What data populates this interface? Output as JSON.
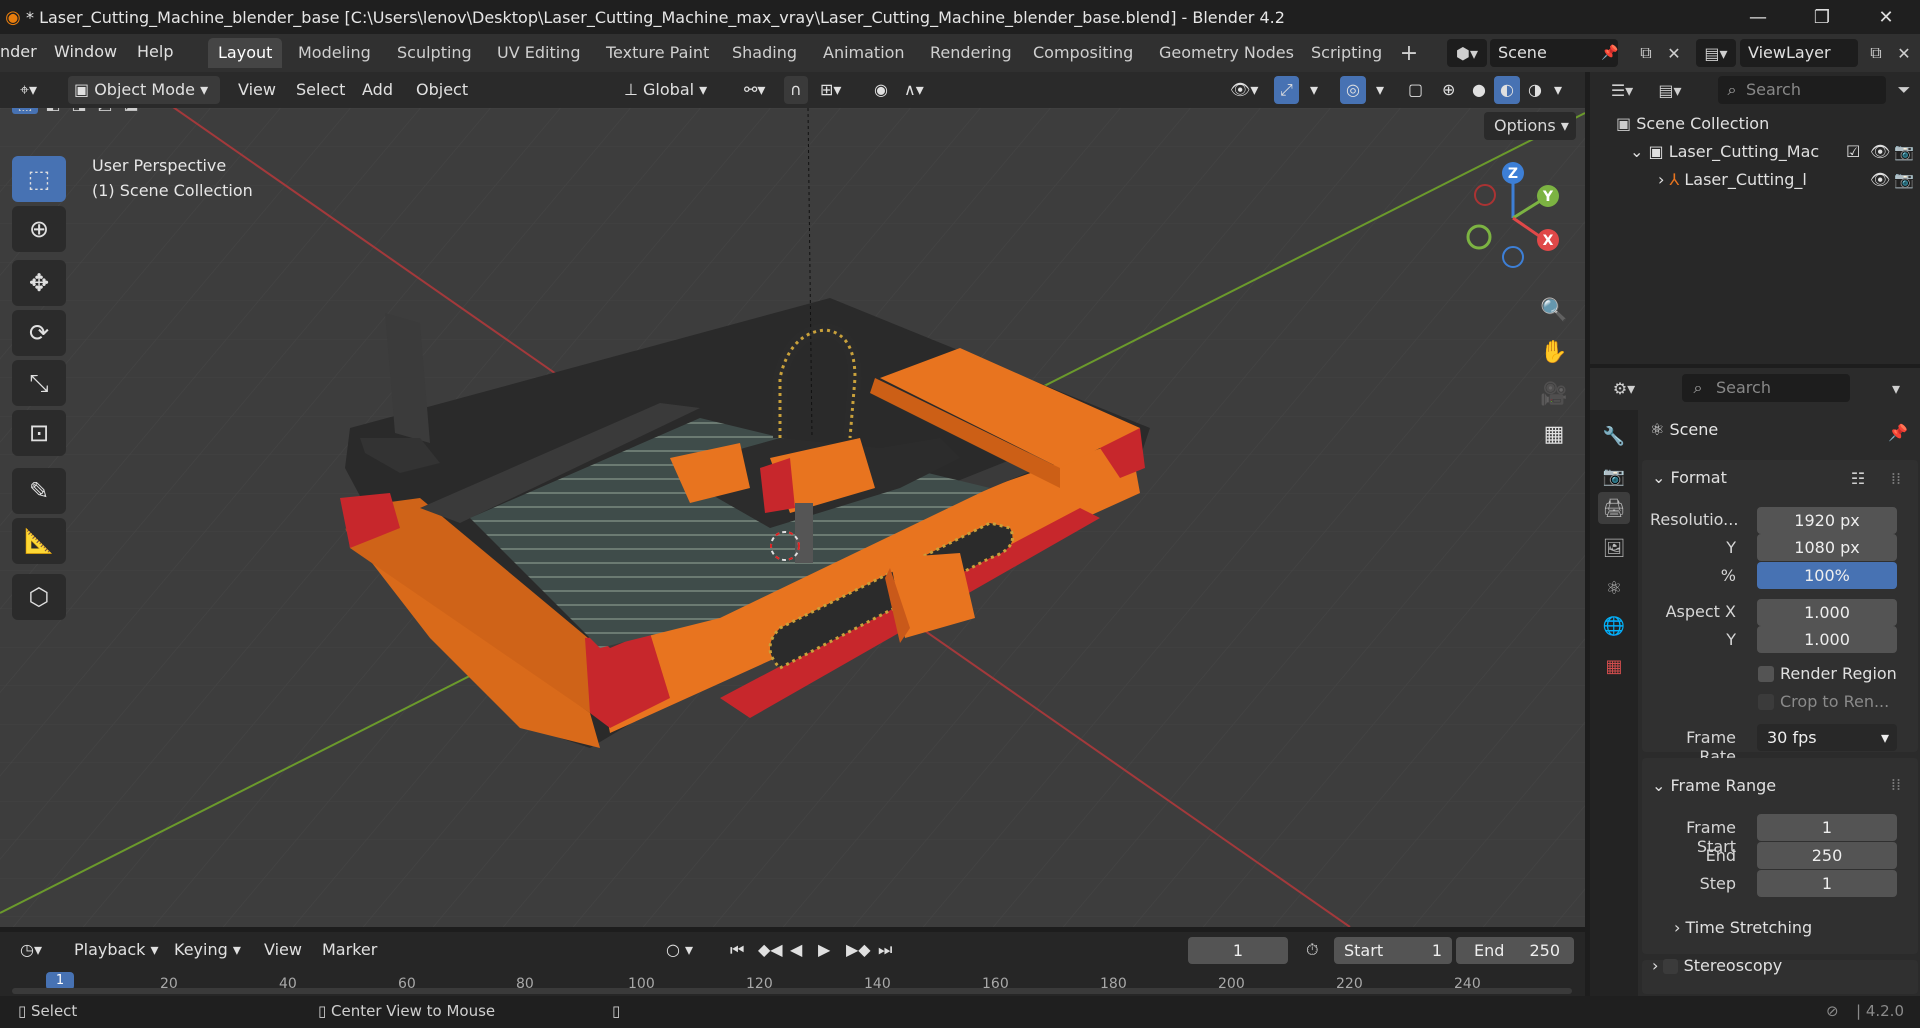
{
  "window": {
    "title": "* Laser_Cutting_Machine_blender_base [C:\\Users\\lenov\\Desktop\\Laser_Cutting_Machine_max_vray\\Laser_Cutting_Machine_blender_base.blend] - Blender 4.2"
  },
  "menus": [
    "nder",
    "Window",
    "Help"
  ],
  "workspaces": [
    "Layout",
    "Modeling",
    "Sculpting",
    "UV Editing",
    "Texture Paint",
    "Shading",
    "Animation",
    "Rendering",
    "Compositing",
    "Geometry Nodes",
    "Scripting"
  ],
  "scene_field": "Scene",
  "viewlayer_field": "ViewLayer",
  "viewport_header": {
    "mode": "Object Mode",
    "menus": [
      "View",
      "Select",
      "Add",
      "Object"
    ],
    "transform": "Global",
    "options": "Options"
  },
  "viewport": {
    "perspective": "User Perspective",
    "collection": "(1) Scene Collection",
    "gizmo": {
      "x": "X",
      "y": "Y",
      "z": "Z"
    }
  },
  "outliner": {
    "search_placeholder": "Search",
    "root": "Scene Collection",
    "items": [
      "Laser_Cutting_Mac",
      "Laser_Cutting_l"
    ]
  },
  "properties": {
    "search_placeholder": "Search",
    "context": "Scene",
    "format": {
      "header": "Format",
      "resolution_label": "Resolutio...",
      "res_x": "1920 px",
      "y_label": "Y",
      "res_y": "1080 px",
      "pct_label": "%",
      "pct": "100%",
      "aspect_label": "Aspect X",
      "aspect_x": "1.000",
      "aspect_y_label": "Y",
      "aspect_y": "1.000",
      "render_region": "Render Region",
      "crop": "Crop to Ren...",
      "frame_rate_label": "Frame Rate",
      "frame_rate": "30 fps"
    },
    "frame_range": {
      "header": "Frame Range",
      "start_label": "Frame Start",
      "start": "1",
      "end_label": "End",
      "end": "250",
      "step_label": "Step",
      "step": "1",
      "time_stretching": "Time Stretching",
      "stereoscopy": "Stereoscopy"
    }
  },
  "timeline": {
    "menus": [
      "Playback",
      "Keying",
      "View",
      "Marker"
    ],
    "current_frame": "1",
    "start_label": "Start",
    "start": "1",
    "end_label": "End",
    "end": "250",
    "ruler": [
      "1",
      "20",
      "40",
      "60",
      "80",
      "100",
      "120",
      "140",
      "160",
      "180",
      "200",
      "220",
      "240"
    ]
  },
  "statusbar": {
    "select": "Select",
    "center": "Center View to Mouse",
    "version": "4.2.0"
  },
  "colors": {
    "accent_blue": "#4772b3",
    "machine_orange": "#e8741f",
    "machine_red": "#c7272c",
    "axis_red": "#a3393b",
    "axis_green": "#6b9a2c"
  }
}
